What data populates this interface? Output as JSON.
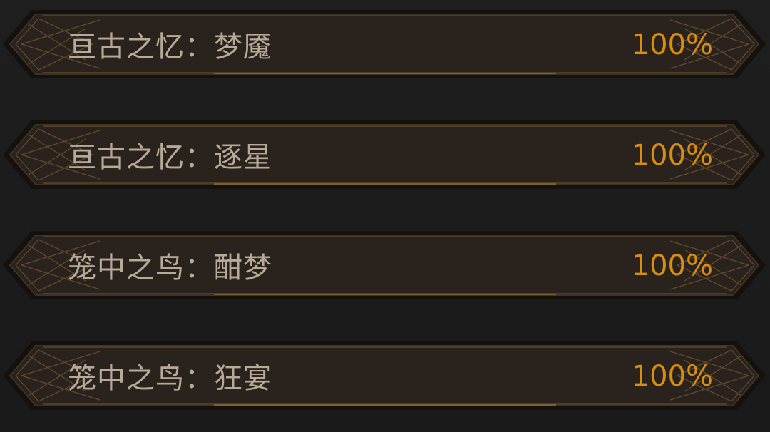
{
  "achievements": [
    {
      "name": "亘古之忆：梦魇",
      "percent": "100%"
    },
    {
      "name": "亘古之忆：逐星",
      "percent": "100%"
    },
    {
      "name": "笼中之鸟：酣梦",
      "percent": "100%"
    },
    {
      "name": "笼中之鸟：狂宴",
      "percent": "100%"
    }
  ],
  "colors": {
    "background": "#1b1b1b",
    "panel": "#2a221c",
    "border_gold": "#7a6230",
    "name_text": "#b6aa98",
    "percent_text": "#d88e10"
  }
}
